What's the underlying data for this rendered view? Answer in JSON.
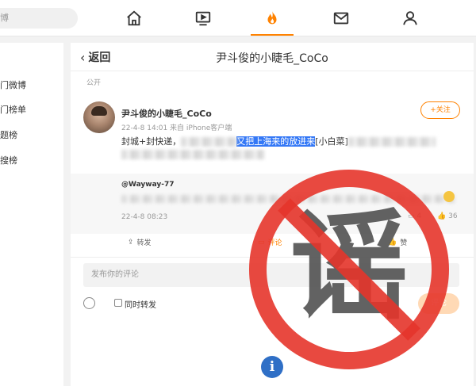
{
  "topbar": {
    "search_placeholder": "博",
    "icons": [
      "home-icon",
      "video-icon",
      "hot-icon",
      "mail-icon",
      "user-icon"
    ],
    "active_tab": "hot",
    "accent": "#ff8200"
  },
  "sidebar": {
    "items": [
      {
        "label": "门微博"
      },
      {
        "label": "门榜单"
      },
      {
        "label": "题榜"
      },
      {
        "label": "搜榜"
      }
    ]
  },
  "header": {
    "back_label": "返回",
    "title": "尹斗俊的小睫毛_CoCo"
  },
  "post": {
    "visibility": "公开",
    "author": "尹斗俊的小睫毛_CoCo",
    "meta": "22-4-8 14:01  来自 iPhone客户端",
    "follow_label": "+关注",
    "text_start": "封城+封快递，",
    "text_highlight": "又把上海来的放进来",
    "text_after": "[小白菜]"
  },
  "reply": {
    "author": "@Wayway-77",
    "time": "22-4-8 08:23",
    "comments": "4",
    "likes": "36"
  },
  "actions": {
    "repost": "转发",
    "comment": "评论",
    "like": "赞"
  },
  "composer": {
    "placeholder": "发布你的评论",
    "repost_checkbox": "同时转发",
    "submit": "评论"
  },
  "stamp": {
    "char": "谣",
    "color": "#e5352b"
  }
}
